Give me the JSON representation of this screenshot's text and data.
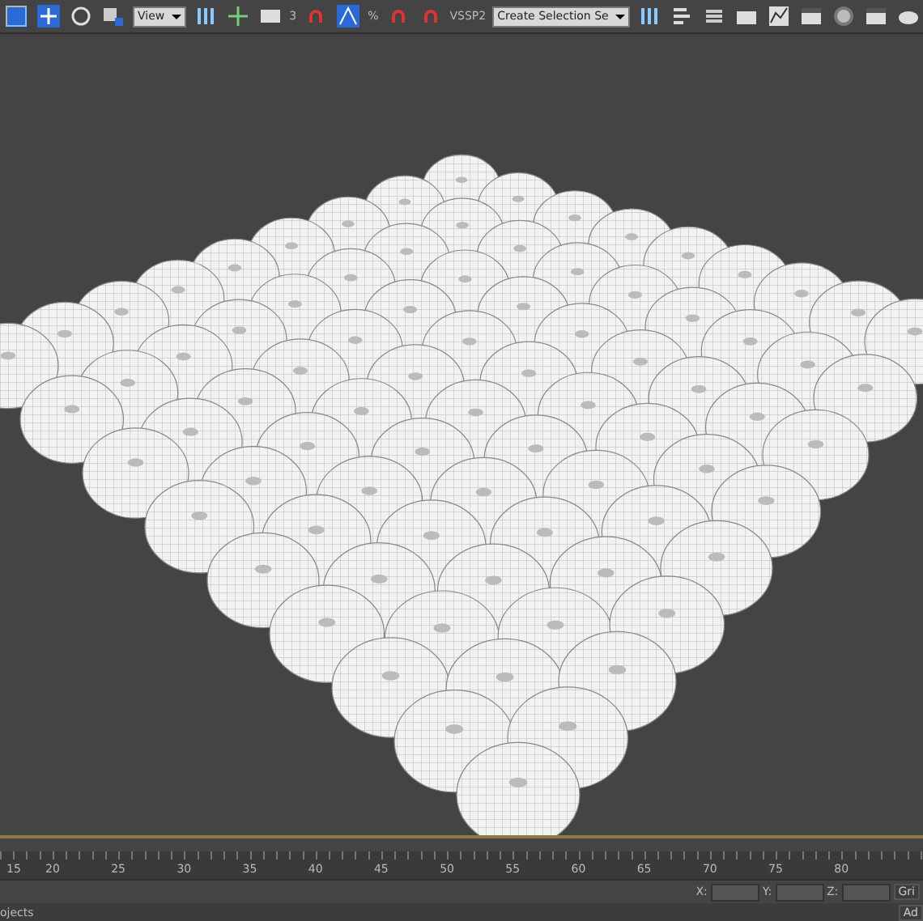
{
  "toolbar": {
    "view_dropdown": "View",
    "snap_angle": "3",
    "snap_percent": "%",
    "label": "VSSP2",
    "selection_set": "Create Selection Se"
  },
  "timeline": {
    "ticks": [
      "15",
      "20",
      "25",
      "30",
      "35",
      "40",
      "45",
      "50",
      "55",
      "60",
      "65",
      "70",
      "75",
      "80"
    ]
  },
  "status": {
    "x_label": "X:",
    "y_label": "Y:",
    "z_label": "Z:",
    "grid": "Gri",
    "prompt": "ojects",
    "add": "Ad"
  }
}
